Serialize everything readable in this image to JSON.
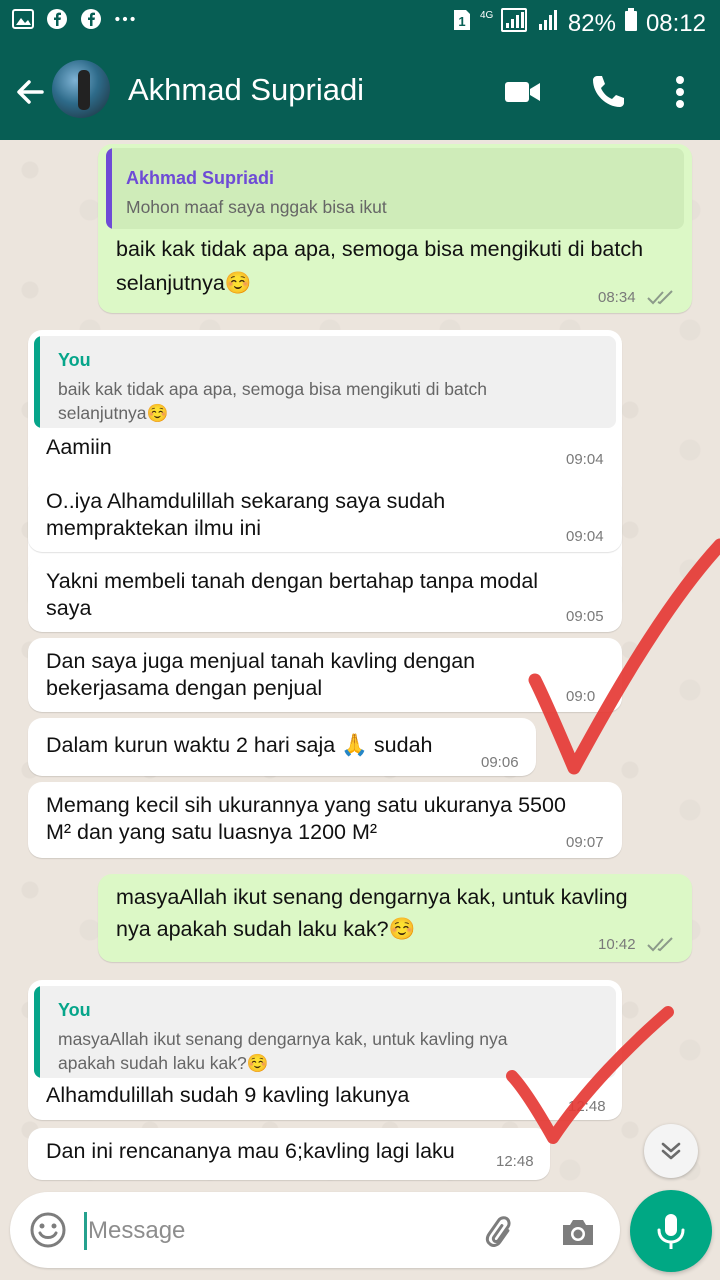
{
  "status_bar": {
    "battery_percent": "82%",
    "time": "08:12",
    "network": "4G",
    "sim_badge": "1",
    "icons": [
      "image-icon",
      "facebook-icon",
      "facebook-icon",
      "more-dots-icon"
    ]
  },
  "header": {
    "contact_name": "Akhmad Supriadi"
  },
  "messages": [
    {
      "direction": "out",
      "quote_author": "Akhmad Supriadi",
      "quote_text": "Mohon maaf saya nggak bisa ikut",
      "text_line1": "baik kak tidak apa apa, semoga bisa mengikuti di batch",
      "text_line2": "selanjutnya☺️",
      "time": "08:34"
    },
    {
      "direction": "in",
      "quote_author": "You",
      "quote_line1": "baik kak tidak apa apa, semoga bisa mengikuti di batch",
      "quote_line2": "selanjutnya☺️",
      "text": "Aamiin",
      "time": "09:04"
    },
    {
      "direction": "in",
      "text_line1": "O..iya Alhamdulillah sekarang saya sudah",
      "text_line2": "mempraktekan ilmu ini",
      "time": "09:04"
    },
    {
      "direction": "in",
      "text_line1": "Yakni membeli tanah dengan bertahap tanpa modal",
      "text_line2": "saya",
      "time": "09:05"
    },
    {
      "direction": "in",
      "text_line1": "Dan saya juga menjual tanah kavling dengan",
      "text_line2": "bekerjasama dengan penjual",
      "time": "09:0"
    },
    {
      "direction": "in",
      "text": "Dalam kurun waktu 2 hari saja 🙏 sudah",
      "time": "09:06"
    },
    {
      "direction": "in",
      "text_line1": "Memang kecil sih ukurannya yang satu ukuranya 5500",
      "text_line2": "M² dan yang satu luasnya 1200 M²",
      "time": "09:07"
    },
    {
      "direction": "out",
      "text_line1": "masyaAllah ikut senang dengarnya kak, untuk kavling",
      "text_line2": "nya apakah sudah laku kak?☺️",
      "time": "10:42"
    },
    {
      "direction": "in",
      "quote_author": "You",
      "quote_line1": "masyaAllah ikut senang dengarnya kak, untuk kavling nya",
      "quote_line2": "apakah sudah laku kak?☺️",
      "text": "Alhamdulillah sudah 9 kavling lakunya",
      "time": "12:48"
    },
    {
      "direction": "in",
      "text": "Dan ini rencananya mau 6;kavling lagi laku",
      "time": "12:48"
    }
  ],
  "input": {
    "placeholder": "Message"
  },
  "colors": {
    "header": "#075E54",
    "outgoing_bubble": "#DCF8C6",
    "incoming_bubble": "#FFFFFF",
    "quote_you": "#06A58A",
    "quote_contact": "#6E4BD6",
    "checkmark_overlay": "#E53935",
    "mic_button": "#00A884"
  }
}
